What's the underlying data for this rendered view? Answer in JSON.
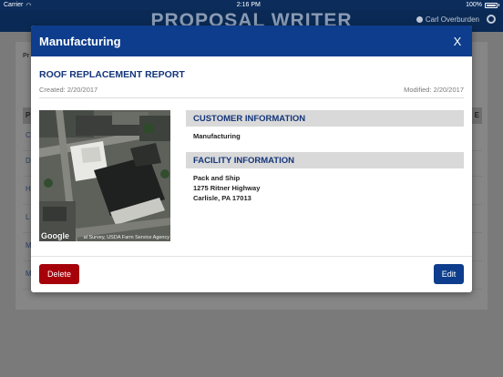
{
  "status_bar": {
    "carrier": "Carrier",
    "time": "2:16 PM",
    "battery": "100%"
  },
  "app": {
    "title": "PROPOSAL WRITER",
    "user": "Carl Overburden",
    "panel_label": "Pr",
    "header_letter": "P",
    "header_letter_right": "E",
    "rows": [
      "C",
      "D",
      "H",
      "L",
      "M",
      "M"
    ]
  },
  "modal": {
    "title": "Manufacturing",
    "close": "X",
    "report_title": "ROOF REPLACEMENT REPORT",
    "created": "Created: 2/20/2017",
    "modified": "Modified: 2/20/2017",
    "map": {
      "logo": "Google",
      "attribution": "al Survey, USDA Farm Service Agency"
    },
    "customer": {
      "heading": "CUSTOMER INFORMATION",
      "name": "Manufacturing"
    },
    "facility": {
      "heading": "FACILITY INFORMATION",
      "lines": [
        "Pack and Ship",
        "1275 Ritner Highway",
        "Carlisle, PA 17013"
      ]
    },
    "buttons": {
      "delete": "Delete",
      "edit": "Edit"
    }
  },
  "colors": {
    "primary": "#0d3d8c",
    "danger": "#a6000a",
    "section_bg": "#d9d9d9"
  }
}
